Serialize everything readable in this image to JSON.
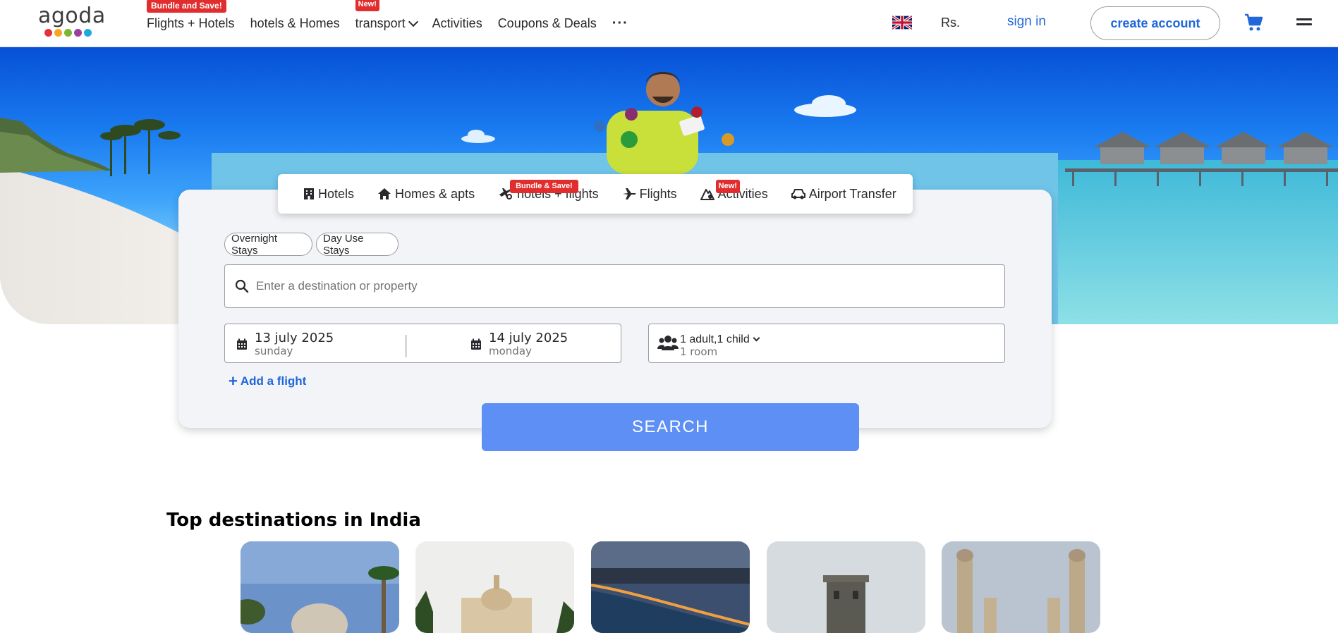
{
  "brand": {
    "name": "agoda",
    "dot_colors": [
      "#e8303b",
      "#f5a623",
      "#7cb82f",
      "#9b3f9e",
      "#1ea9e1"
    ]
  },
  "header": {
    "nav": [
      {
        "label": "Flights + Hotels",
        "badge": "Bundle and Save!"
      },
      {
        "label": "hotels & Homes",
        "badge": ""
      },
      {
        "label": "transport",
        "badge": "New!"
      },
      {
        "label": "Activities",
        "badge": ""
      },
      {
        "label": "Coupons & Deals",
        "badge": ""
      },
      {
        "label": "···",
        "badge": ""
      }
    ],
    "currency": "Rs.",
    "sign_in": "sign in",
    "create_account": "create account"
  },
  "search": {
    "tabs": [
      {
        "label": "Hotels",
        "icon": "hotel-icon",
        "badge": ""
      },
      {
        "label": "Homes & apts",
        "icon": "home-icon",
        "badge": ""
      },
      {
        "label": "hotels + flights",
        "icon": "bundle-icon",
        "badge": "Bundle & Save!"
      },
      {
        "label": "Flights",
        "icon": "plane-icon",
        "badge": ""
      },
      {
        "label": "Activities",
        "icon": "activities-icon",
        "badge": "New!"
      },
      {
        "label": "Airport Transfer",
        "icon": "car-icon",
        "badge": ""
      }
    ],
    "stay_types": [
      "Overnight Stays",
      "Day Use Stays"
    ],
    "destination_placeholder": "Enter a destination or property",
    "checkin": {
      "date": "13 july 2025",
      "day": "sunday"
    },
    "checkout": {
      "date": "14 july 2025",
      "day": "monday"
    },
    "guests": {
      "summary": "1 adult,1 child",
      "rooms": "1 room"
    },
    "add_flight": "Add a flight",
    "button": "SEARCH"
  },
  "destinations": {
    "title": "Top destinations in India"
  },
  "colors": {
    "accent": "#2067da",
    "search_button": "#5e8ff5",
    "badge": "#e12d2d"
  }
}
